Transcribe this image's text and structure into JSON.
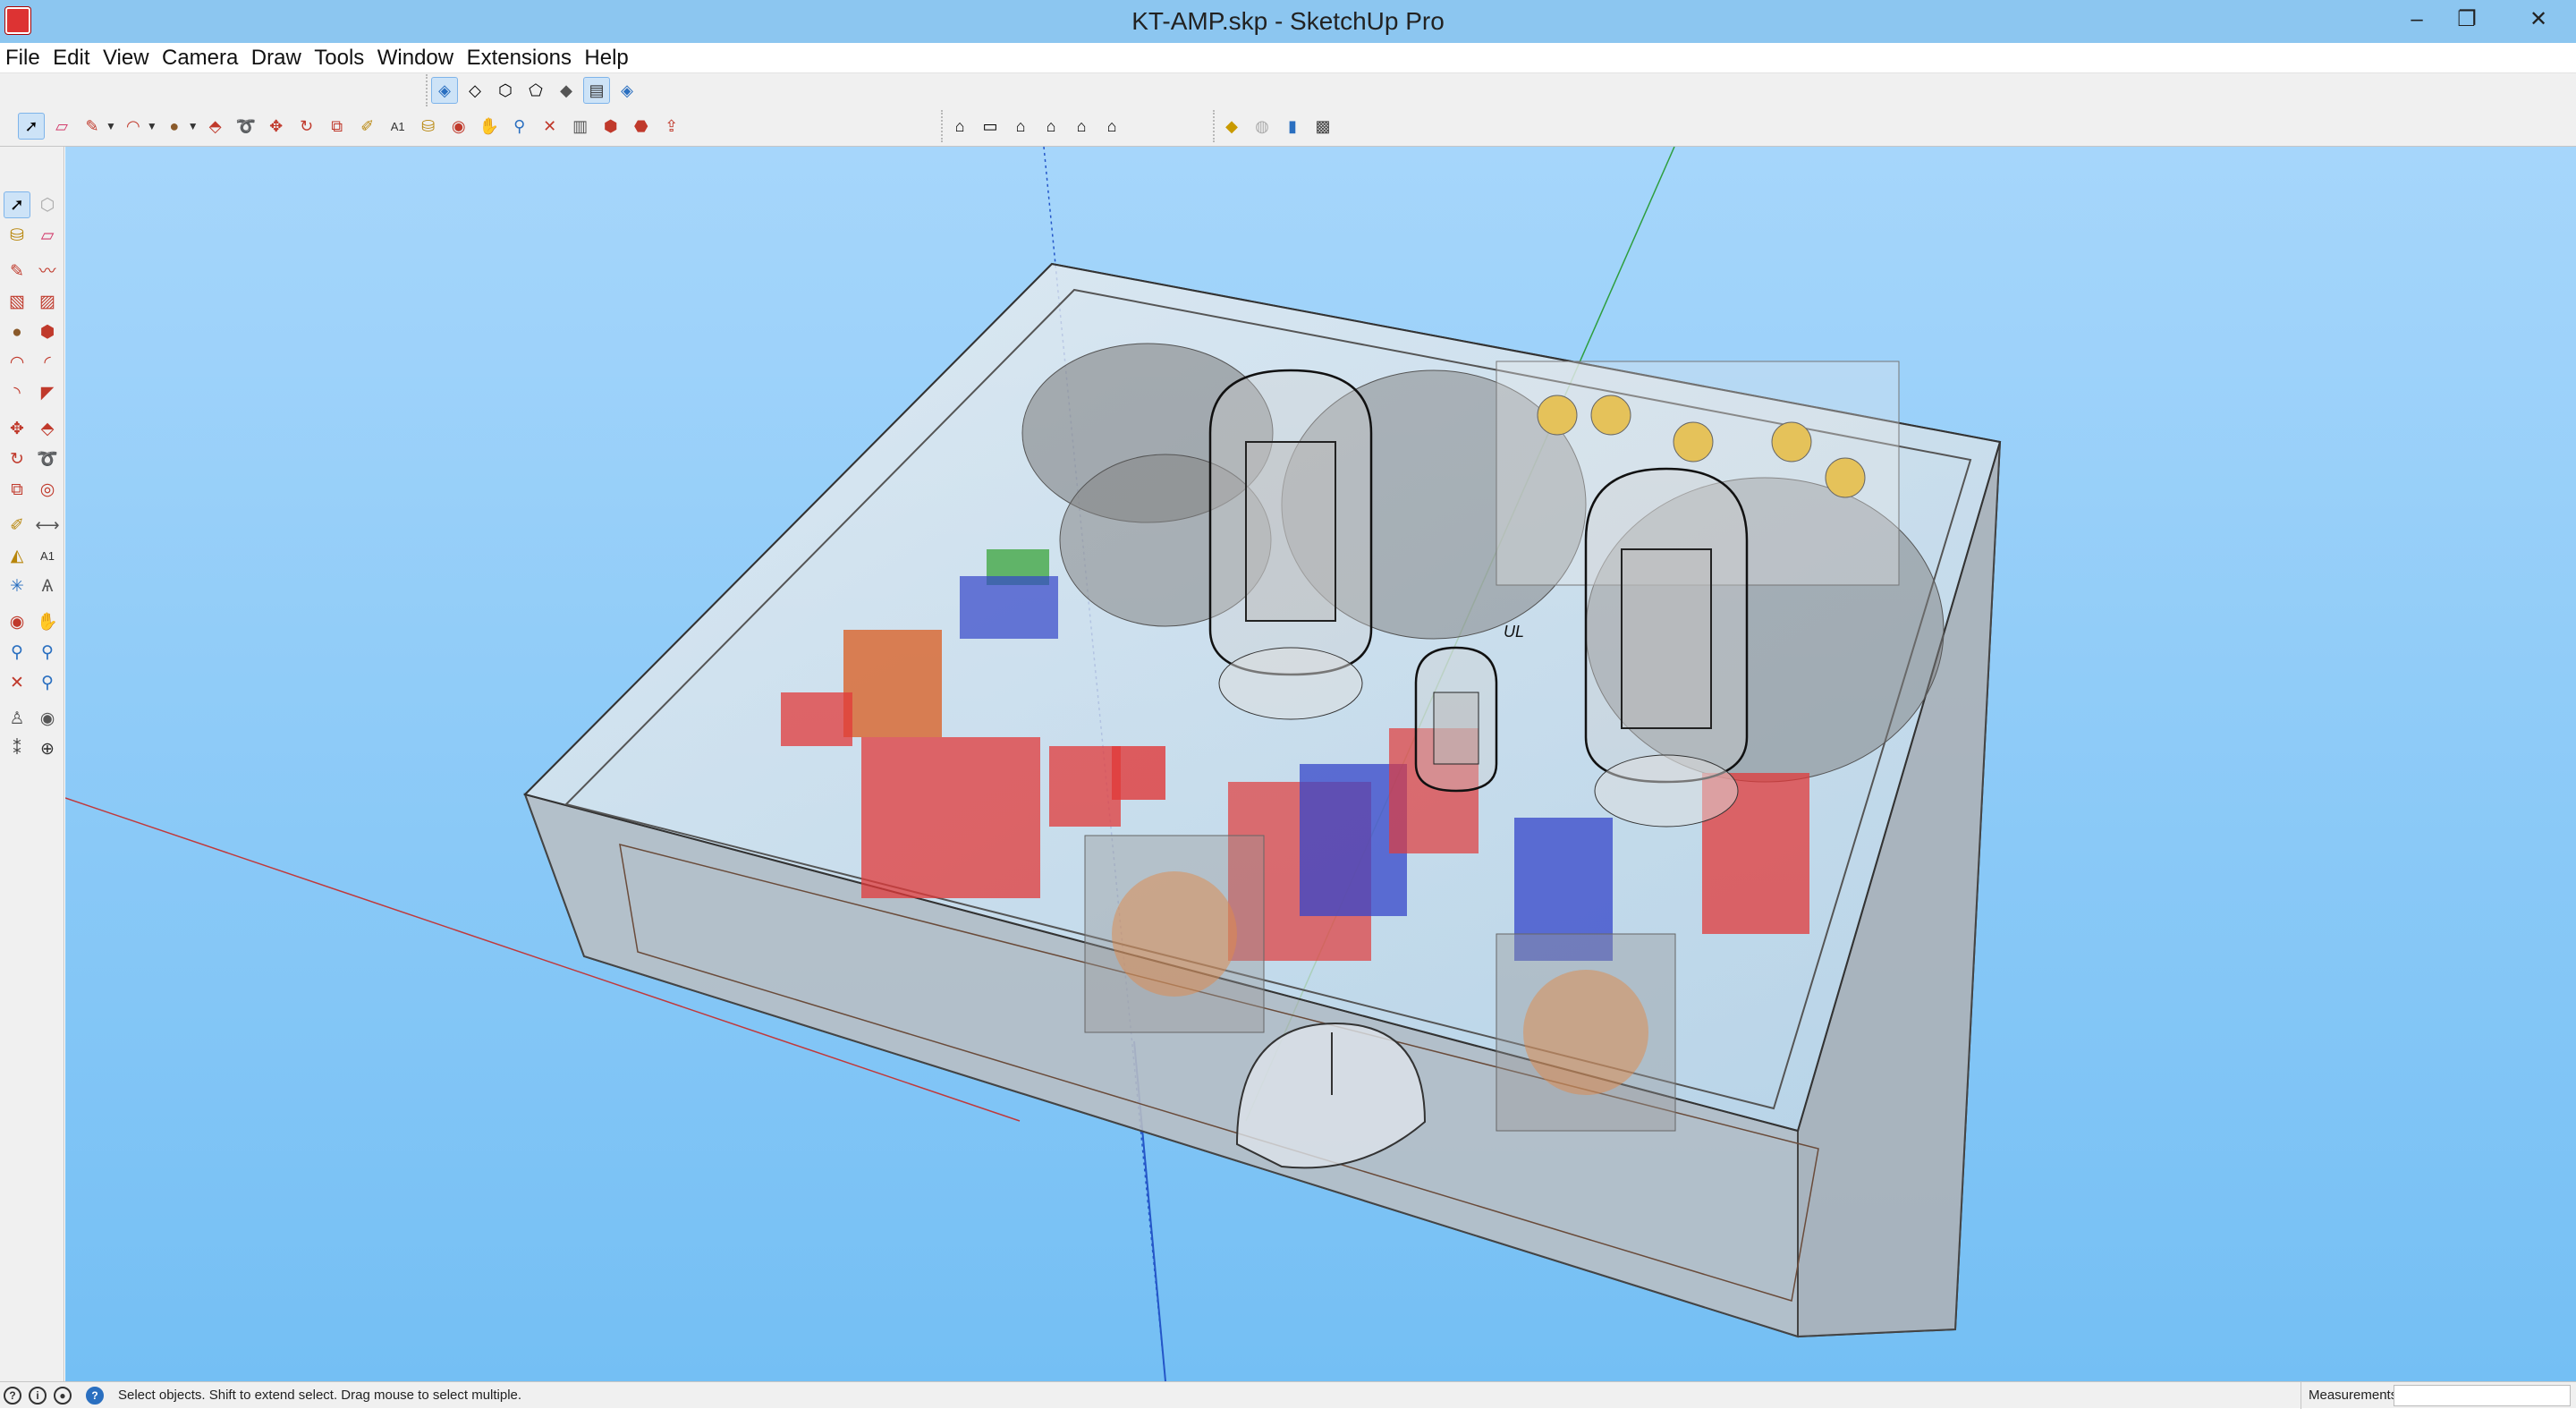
{
  "window": {
    "title": "KT-AMP.skp - SketchUp Pro",
    "minimize_glyph": "–",
    "restore_glyph": "❐",
    "close_glyph": "✕"
  },
  "menu": [
    "File",
    "Edit",
    "View",
    "Camera",
    "Draw",
    "Tools",
    "Window",
    "Extensions",
    "Help"
  ],
  "icons": {
    "app": "sketchup-logo-icon",
    "toolbar_styles": [
      "xray-icon",
      "back-edges-icon",
      "wireframe-icon",
      "hidden-line-icon",
      "shaded-icon",
      "shaded-textures-icon",
      "monochrome-icon"
    ],
    "toolbar_main": [
      "select-icon",
      "eraser-icon",
      "line-icon",
      "arc-icon",
      "shape-icon",
      "push-pull-icon",
      "follow-me-icon",
      "move-icon",
      "rotate-icon",
      "scale-icon",
      "tape-measure-icon",
      "text-icon",
      "paint-bucket-icon",
      "orbit-icon",
      "pan-icon",
      "zoom-icon",
      "zoom-extents-icon",
      "warehouse-icon",
      "extension-warehouse-icon",
      "layout-icon",
      "share-model-icon"
    ],
    "toolbar_views": [
      "iso-view-icon",
      "top-view-icon",
      "front-view-icon",
      "right-view-icon",
      "back-view-icon",
      "left-view-icon"
    ],
    "toolbar_extra": [
      "section-plane-icon",
      "section-display-icon",
      "section-cut-icon",
      "camera-tool-icon"
    ],
    "status": [
      "geo-location-icon",
      "credits-icon",
      "user-icon",
      "instructor-icon"
    ]
  },
  "status": {
    "hint": "Select objects. Shift to extend select. Drag mouse to select multiple.",
    "measurements_label": "Measurements",
    "measurements_value": ""
  },
  "viewport": {
    "background_top": "#a6d6fb",
    "background_bottom": "#74bff4",
    "model_label": "UL"
  },
  "colors": {
    "titlebar": "#8cc6f0",
    "axis_red": "#c0393b",
    "axis_green": "#2e9e3e",
    "axis_blue": "#2456c8",
    "component_red": "#e13a3a",
    "component_blue": "#3546c9",
    "component_green": "#3ba43b",
    "component_orange": "#d9642b"
  }
}
